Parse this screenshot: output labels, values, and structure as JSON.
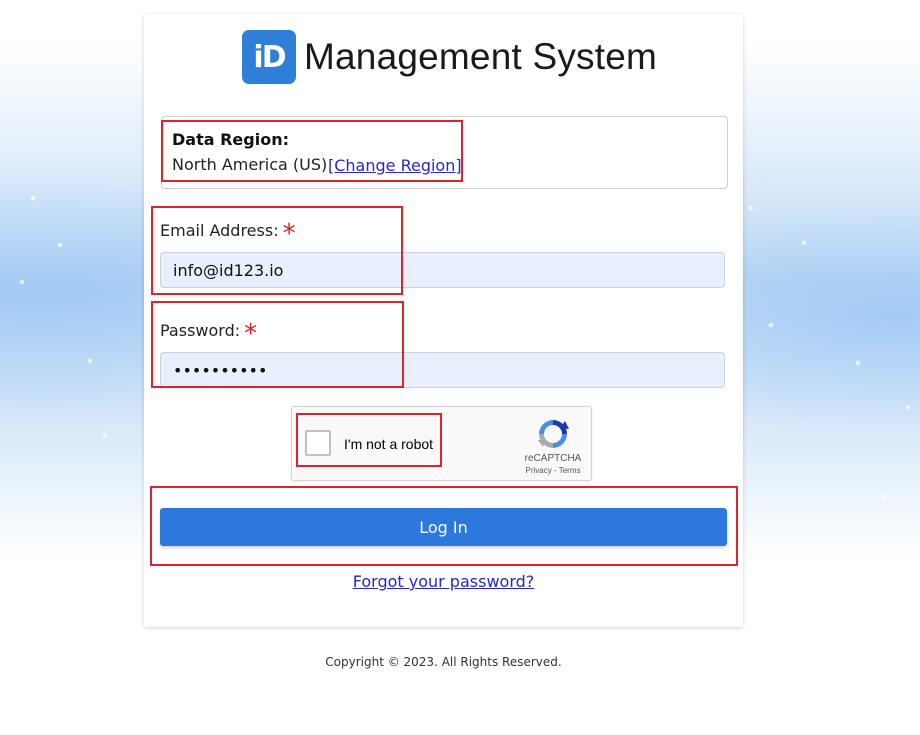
{
  "header": {
    "logo_text": "iD",
    "app_title": "Management System"
  },
  "region": {
    "title": "Data Region:",
    "value": "North America (US)",
    "change_link": "[Change Region]"
  },
  "email": {
    "label": "Email Address:",
    "required_mark": "*",
    "value": "info@id123.io"
  },
  "password": {
    "label": "Password:",
    "required_mark": "*",
    "value": "••••••••••"
  },
  "captcha": {
    "label": "I'm not a robot",
    "brand": "reCAPTCHA",
    "privacy": "Privacy",
    "separator": " - ",
    "terms": "Terms",
    "checked": false
  },
  "actions": {
    "login_label": "Log In",
    "forgot_label": "Forgot your password?"
  },
  "footer": {
    "copyright": "Copyright © 2023. All Rights Reserved."
  },
  "colors": {
    "brand_blue": "#2e7fd8",
    "button_blue": "#2c78dc",
    "link": "#2727cc",
    "required": "#e02020",
    "highlight_red": "#e0212e",
    "input_bg": "#e8f0fe"
  },
  "icons": [
    "recaptcha-logo-icon"
  ]
}
